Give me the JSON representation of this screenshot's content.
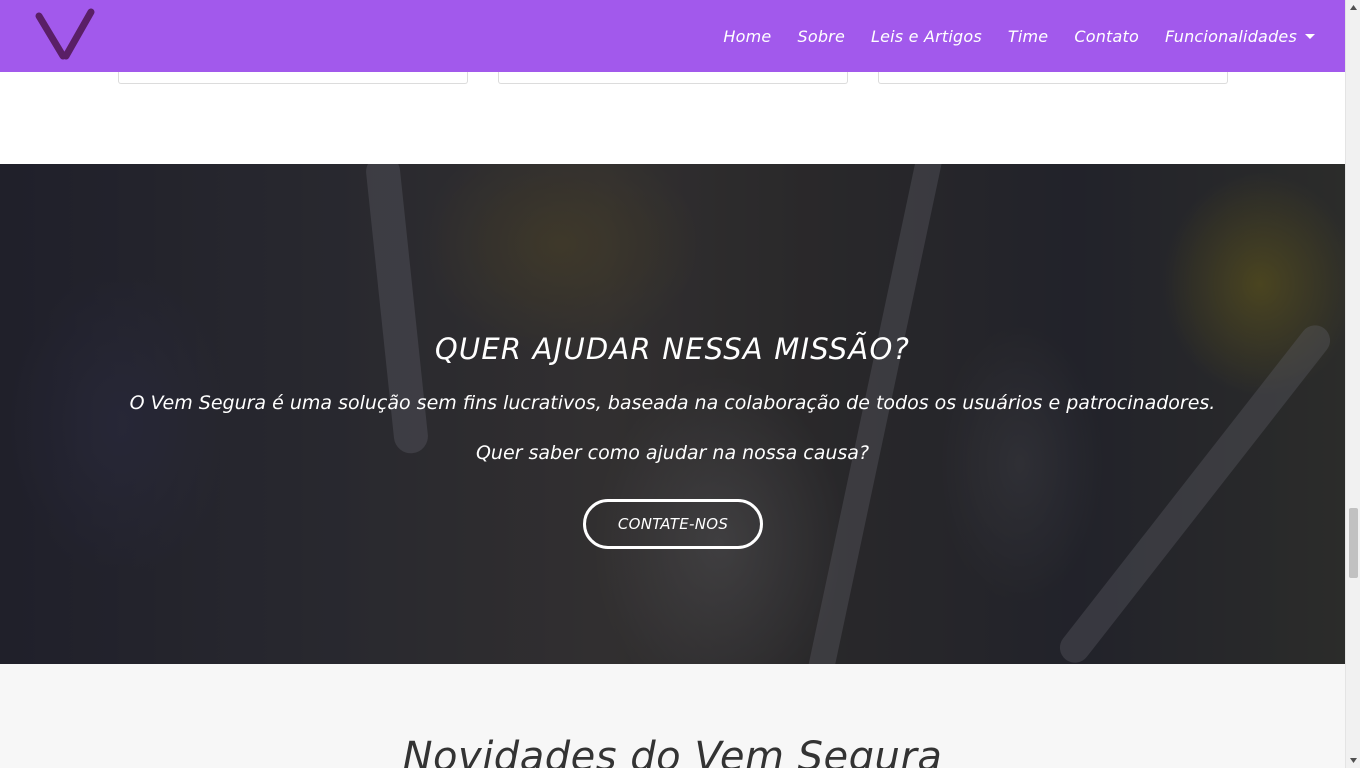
{
  "nav": {
    "logo_alt": "Vem Segura",
    "items": [
      {
        "label": "Home"
      },
      {
        "label": "Sobre"
      },
      {
        "label": "Leis e Artigos"
      },
      {
        "label": "Time"
      },
      {
        "label": "Contato"
      }
    ],
    "dropdown_label": "Funcionalidades"
  },
  "hero": {
    "title": "QUER AJUDAR NESSA MISSÃO?",
    "description": "O Vem Segura é uma solução sem fins lucrativos, baseada na colaboração de todos os usuários e patrocinadores.",
    "question": "Quer saber como ajudar na nossa causa?",
    "cta_label": "CONTATE-NOS"
  },
  "news": {
    "title": "Novidades do Vem Segura"
  },
  "colors": {
    "navbar": "#a259ec",
    "logo": "#5a1f66"
  }
}
